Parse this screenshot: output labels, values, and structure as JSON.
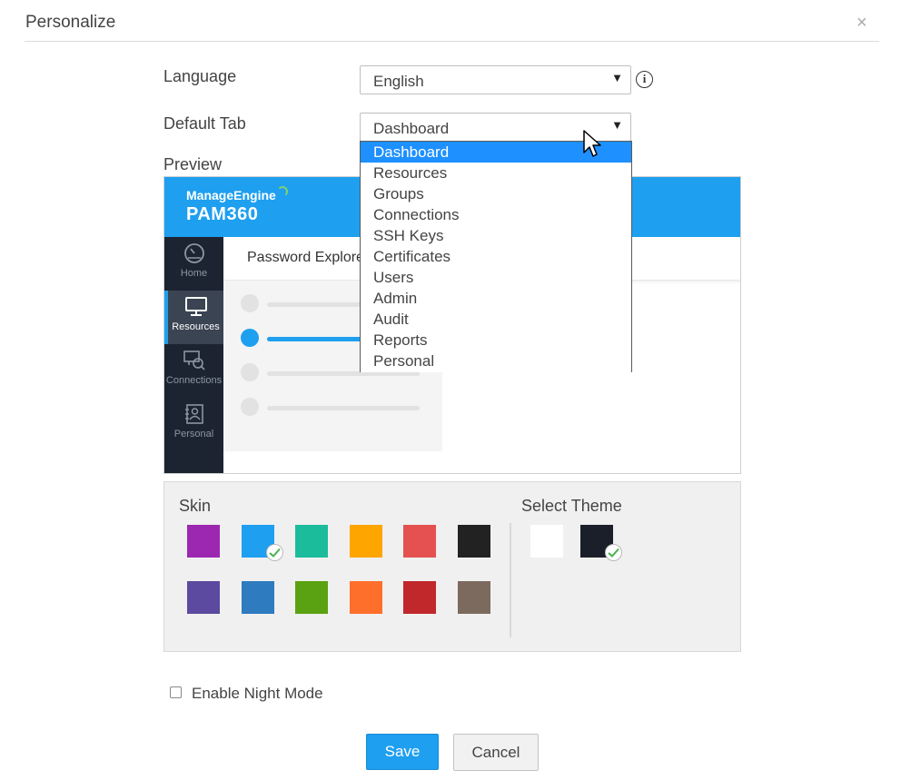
{
  "dialog": {
    "title": "Personalize",
    "close_glyph": "×"
  },
  "form": {
    "language_label": "Language",
    "language_value": "English",
    "default_tab_label": "Default Tab",
    "default_tab_value": "Dashboard",
    "preview_label": "Preview"
  },
  "dropdown": {
    "selected": "Dashboard",
    "options": [
      "Dashboard",
      "Resources",
      "Groups",
      "Connections",
      "SSH Keys",
      "Certificates",
      "Users",
      "Admin",
      "Audit",
      "Reports",
      "Personal"
    ]
  },
  "preview": {
    "brand_line1": "ManageEngine",
    "brand_line2": "PAM360",
    "tab_label": "Password Explorer",
    "nav": [
      {
        "label": "Home",
        "icon": "dashboard-gauge-icon"
      },
      {
        "label": "Resources",
        "icon": "monitor-icon",
        "active": true
      },
      {
        "label": "Connections",
        "icon": "connections-icon"
      },
      {
        "label": "Personal",
        "icon": "contact-book-icon"
      }
    ]
  },
  "skin": {
    "label": "Skin",
    "selected_color": "#1e9ff0",
    "colors": [
      "#9c27b0",
      "#1e9ff0",
      "#1abc9c",
      "#ffa500",
      "#e55050",
      "#222222",
      "#5b4a9f",
      "#2e7bc0",
      "#5aa211",
      "#ff6f2c",
      "#c0282b",
      "#7d6a5e"
    ]
  },
  "theme": {
    "label": "Select Theme",
    "selected_color": "#1a1f29",
    "colors": [
      "#ffffff",
      "#1a1f29"
    ]
  },
  "night_mode": {
    "label": "Enable Night Mode",
    "checked": false
  },
  "buttons": {
    "save": "Save",
    "cancel": "Cancel"
  }
}
